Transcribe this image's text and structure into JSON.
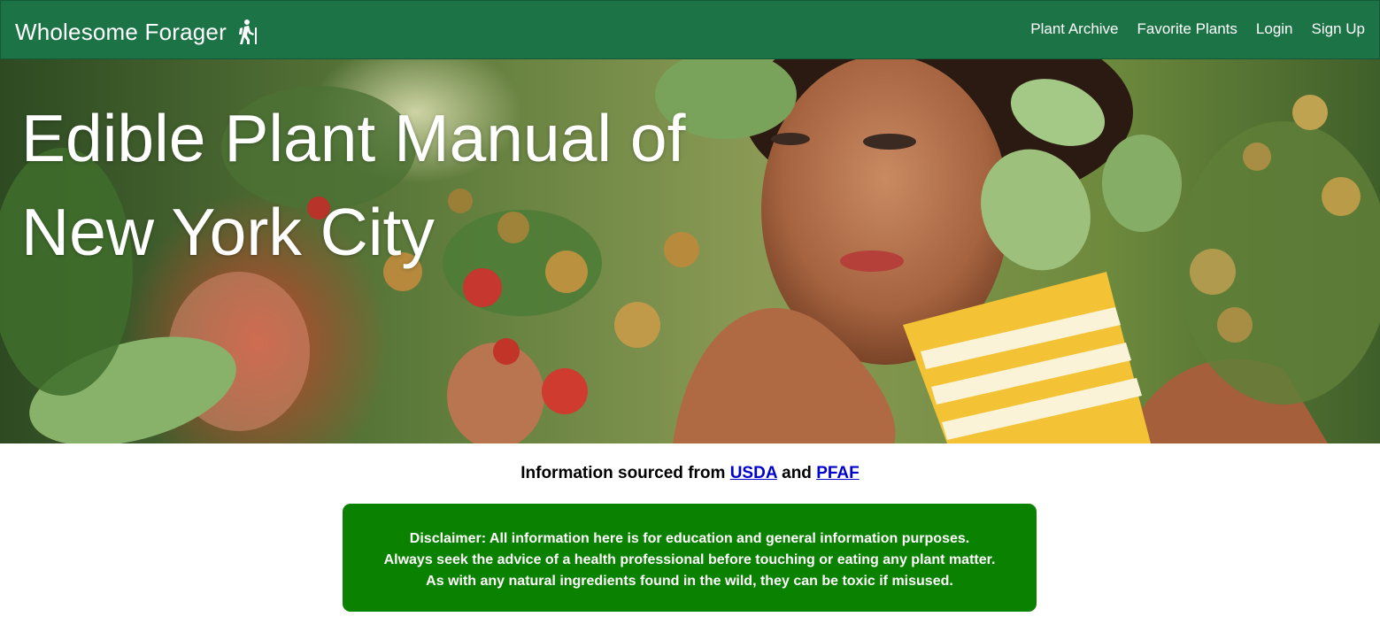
{
  "navbar": {
    "brand": "Wholesome Forager",
    "brand_icon": "hiker-icon",
    "links": [
      "Plant Archive",
      "Favorite Plants",
      "Login",
      "Sign Up"
    ],
    "background": "#1c7346"
  },
  "hero": {
    "title_line1": "Edible Plant Manual of",
    "title_line2": "New York City",
    "image": "photo of a girl picking raspberries among green leaves"
  },
  "source": {
    "prefix": "Information sourced from",
    "link1": "USDA",
    "conjunction": "and",
    "link2": "PFAF"
  },
  "disclaimer": {
    "line1": "Disclaimer: All information here is for education and general information purposes.",
    "line2": "Always seek the advice of a health professional before touching or eating any plant matter.",
    "line3": "As with any natural ingredients found in the wild, they can be toxic if misused.",
    "background": "#0a8200"
  }
}
